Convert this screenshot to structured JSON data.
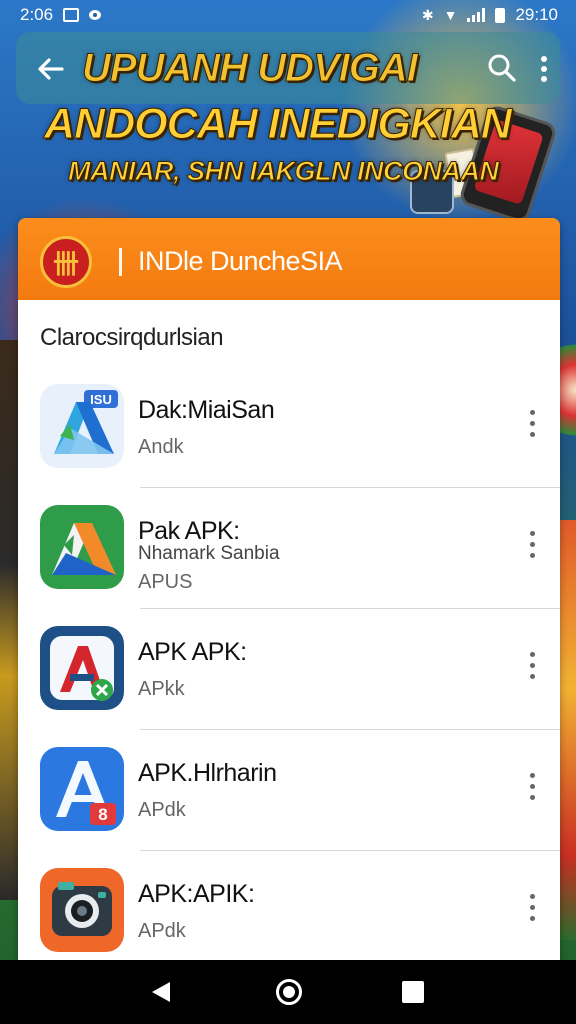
{
  "status_bar": {
    "time_left": "2:06",
    "time_right": "29:10"
  },
  "banner": {
    "line1": "UPUANH UDVIGAI",
    "line2": "ANDOCAH INEDIGKIAN",
    "line3": "MANIAR, SHN IAKGLN INCONAAN"
  },
  "header": {
    "title": "INDle DuncheSIA"
  },
  "section": {
    "label": "Clarocsirqdurlsian"
  },
  "apps": [
    {
      "name": "Dak:MiaiSan",
      "lines": [
        "Andk"
      ],
      "icon": "drive-style-blue-app-icon"
    },
    {
      "name": "Pak APK:",
      "lines": [
        "Nhamark Sanbia",
        "APUS"
      ],
      "icon": "drive-style-green-app-icon"
    },
    {
      "name": "APK APK:",
      "lines": [
        "APkk"
      ],
      "icon": "letter-a-red-app-icon"
    },
    {
      "name": "APK.Hlrharin",
      "lines": [
        "APdk"
      ],
      "icon": "letter-a-blue-app-icon"
    },
    {
      "name": "APK:APIK:",
      "lines": [
        "APdk"
      ],
      "icon": "camera-orange-app-icon"
    }
  ],
  "colors": {
    "header_orange": "#f47a10",
    "banner_gold": "#ffcf35",
    "logo_red": "#c9201f"
  }
}
